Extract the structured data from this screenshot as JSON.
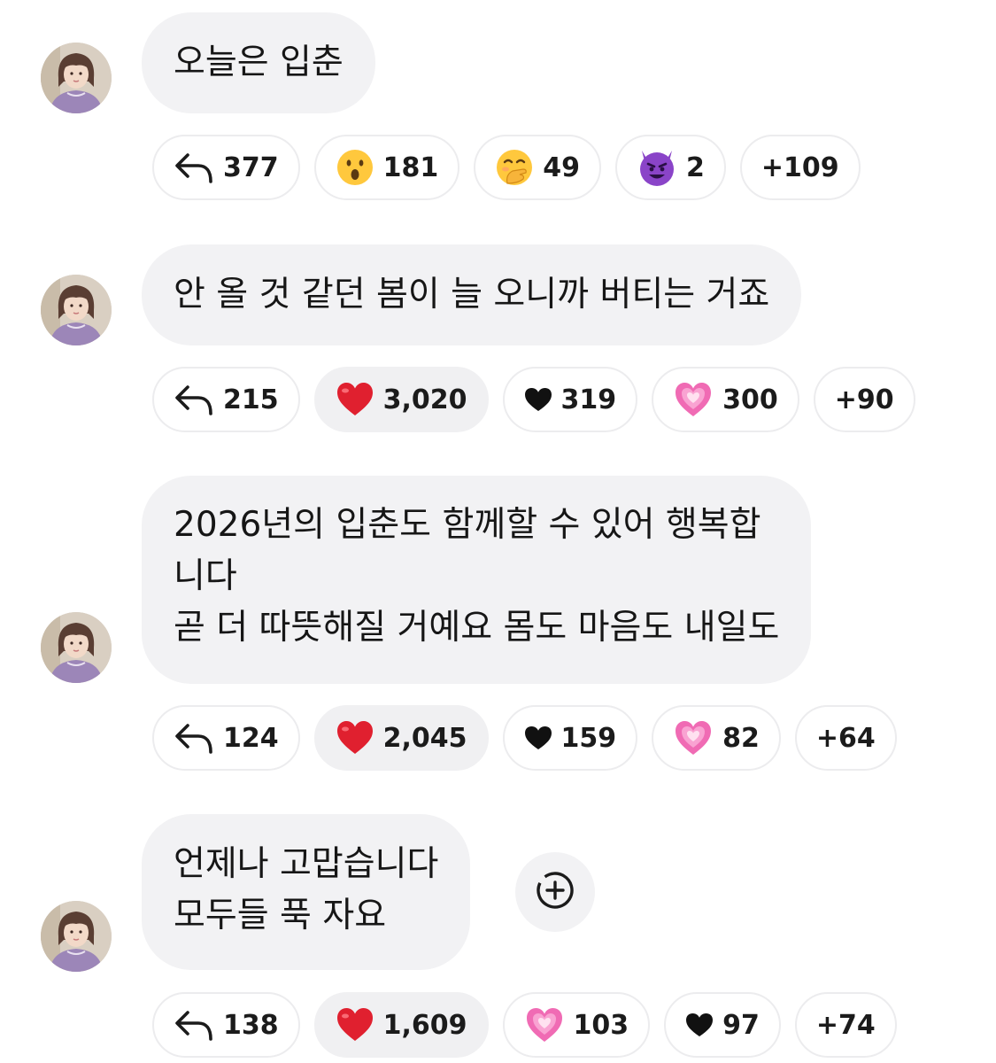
{
  "messages": [
    {
      "lines": [
        "오늘은 입춘"
      ],
      "reactions": [
        {
          "icon": "reply-arrow-icon",
          "count": "377"
        },
        {
          "icon": "astonished-face-emoji",
          "count": "181"
        },
        {
          "icon": "face-with-hand-over-mouth-emoji",
          "count": "49"
        },
        {
          "icon": "smiling-devil-emoji",
          "count": "2"
        },
        {
          "icon": "",
          "count": "+109"
        }
      ]
    },
    {
      "lines": [
        "안 올 것 같던 봄이 늘 오니까 버티는 거죠"
      ],
      "reactions": [
        {
          "icon": "reply-arrow-icon",
          "count": "215"
        },
        {
          "icon": "red-heart-emoji",
          "count": "3,020",
          "selected": true
        },
        {
          "icon": "black-heart-emoji",
          "count": "319"
        },
        {
          "icon": "pink-sparkling-heart-emoji",
          "count": "300"
        },
        {
          "icon": "",
          "count": "+90"
        }
      ]
    },
    {
      "lines": [
        "2026년의 입춘도 함께할 수 있어 행복합",
        "니다",
        "곧 더 따뜻해질 거예요 몸도 마음도 내일도"
      ],
      "reactions": [
        {
          "icon": "reply-arrow-icon",
          "count": "124"
        },
        {
          "icon": "red-heart-emoji",
          "count": "2,045",
          "selected": true
        },
        {
          "icon": "black-heart-emoji",
          "count": "159"
        },
        {
          "icon": "pink-sparkling-heart-emoji",
          "count": "82"
        },
        {
          "icon": "",
          "count": "+64"
        }
      ]
    },
    {
      "lines": [
        "언제나 고맙습니다",
        "모두들 푹 자요"
      ],
      "add_reaction_icon": "add-reaction-icon",
      "reactions": [
        {
          "icon": "reply-arrow-icon",
          "count": "138"
        },
        {
          "icon": "red-heart-emoji",
          "count": "1,609",
          "selected": true
        },
        {
          "icon": "pink-sparkling-heart-emoji",
          "count": "103"
        },
        {
          "icon": "black-heart-emoji",
          "count": "97"
        },
        {
          "icon": "",
          "count": "+74"
        }
      ]
    }
  ],
  "colors": {
    "bubble_bg": "#f2f2f4",
    "chip_border": "#ececee",
    "selected_chip_bg": "#f0f0f2",
    "heart_red": "#e0202f",
    "heart_pink": "#f06bb4",
    "devil_purple": "#8a44c8"
  }
}
